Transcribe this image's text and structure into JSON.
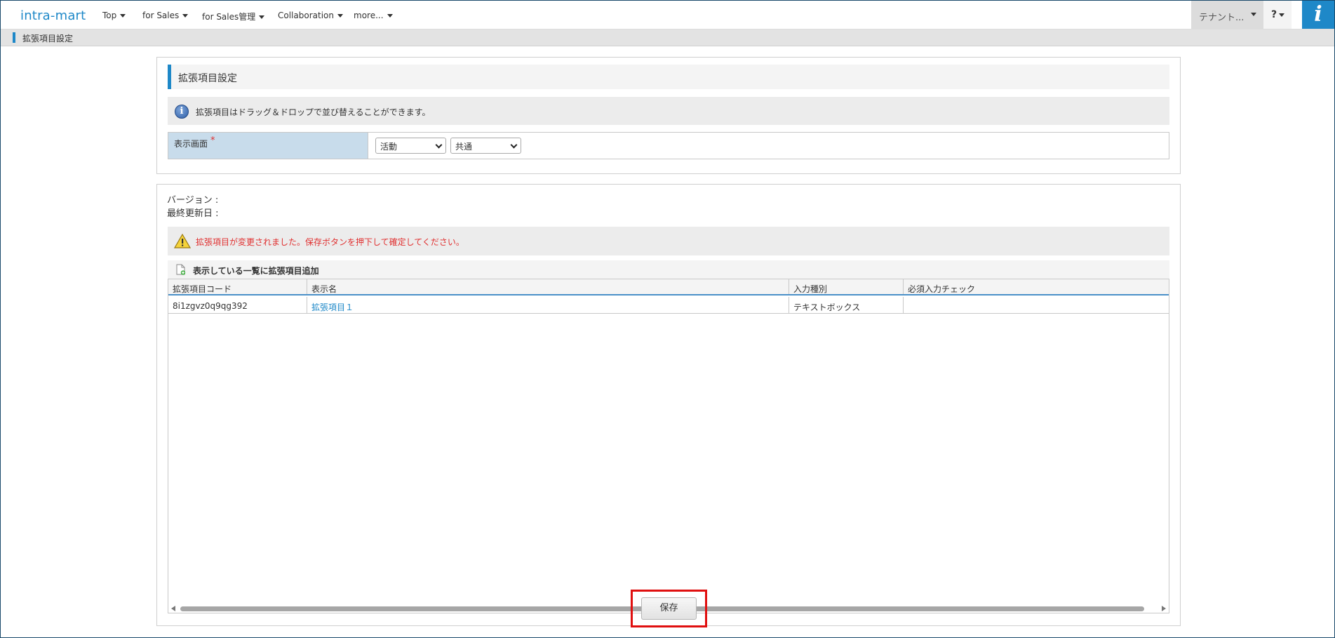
{
  "app": {
    "logo": "intra-mart",
    "nav": [
      {
        "label": "Top"
      },
      {
        "label": "for Sales"
      },
      {
        "label": "for Sales管理"
      },
      {
        "label": "Collaboration"
      },
      {
        "label": "more..."
      }
    ],
    "tenant_label": "テナント...",
    "help_label": "?",
    "info_button_glyph": "i"
  },
  "breadcrumb": {
    "title": "拡張項目設定"
  },
  "settings": {
    "heading": "拡張項目設定",
    "info_text": "拡張項目はドラッグ＆ドロップで並び替えることができます。",
    "display_screen_label": "表示画面",
    "required_mark": "*",
    "select1": {
      "value": "活動"
    },
    "select2": {
      "value": "共通"
    }
  },
  "items": {
    "version_label": "バージョン :",
    "updated_label": "最終更新日 :",
    "warning_text": "拡張項目が変更されました。保存ボタンを押下して確定してください。",
    "add_link": "表示している一覧に拡張項目追加",
    "columns": [
      "拡張項目コード",
      "表示名",
      "入力種別",
      "必須入力チェック"
    ],
    "rows": [
      {
        "code": "8i1zgvz0q9qg392",
        "name": "拡張項目１",
        "type": "テキストボックス",
        "required": ""
      }
    ],
    "save_label": "保存"
  },
  "colors": {
    "accent": "#1e88c8",
    "warning": "#e03030",
    "highlight": "#e01010"
  }
}
